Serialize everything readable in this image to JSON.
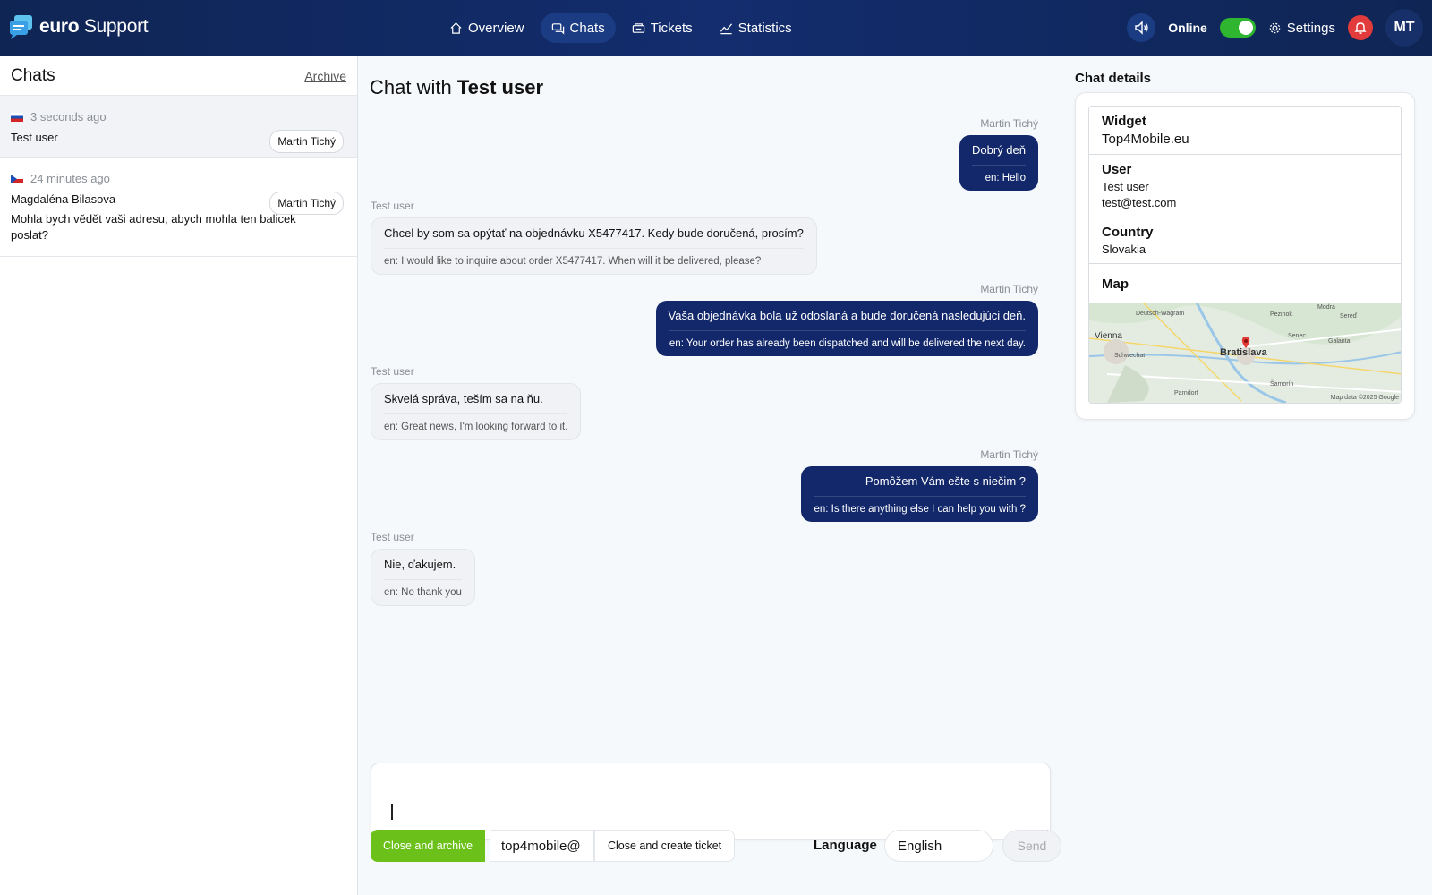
{
  "app": {
    "brand_bold": "euro",
    "brand_light": " Support"
  },
  "nav": [
    {
      "label": "Overview",
      "icon": "home-icon"
    },
    {
      "label": "Chats",
      "icon": "chat-icon",
      "active": true
    },
    {
      "label": "Tickets",
      "icon": "ticket-icon"
    },
    {
      "label": "Statistics",
      "icon": "chart-icon"
    }
  ],
  "header": {
    "online_label": "Online",
    "online": true,
    "settings_label": "Settings",
    "avatar_initials": "MT"
  },
  "colors": {
    "topbar": "#0f2554",
    "accent_green": "#6bc11a",
    "out_bubble": "#12286a",
    "alert_red": "#e23b3b"
  },
  "chats_panel": {
    "title": "Chats",
    "archive_label": "Archive",
    "items": [
      {
        "flag": "sk",
        "time": "3 seconds ago",
        "name": "Test user",
        "agent": "Martin Tichý",
        "preview": ""
      },
      {
        "flag": "cz",
        "time": "24 minutes ago",
        "name": "Magdaléna Bilasova",
        "agent": "Martin Tichý",
        "preview": "Mohla bych vědět vaši adresu, abych mohla ten balicek poslat?"
      }
    ]
  },
  "chat": {
    "title_prefix": "Chat with",
    "title_user": "Test user",
    "messages": [
      {
        "dir": "out",
        "who": "Martin Tichý",
        "text": "Dobrý deň",
        "translation": "en: Hello"
      },
      {
        "dir": "in",
        "who": "Test user",
        "text": "Chcel by som sa opýtať na objednávku X5477417. Kedy bude doručená, prosím?",
        "translation": "en: I would like to inquire about order X5477417. When will it be delivered, please?"
      },
      {
        "dir": "out",
        "who": "Martin Tichý",
        "text": "Vaša objednávka bola už odoslaná a bude doručená nasledujúci deň.",
        "translation": "en: Your order has already been dispatched and will be delivered the next day."
      },
      {
        "dir": "in",
        "who": "Test user",
        "text": "Skvelá správa, teším sa na ňu.",
        "translation": "en: Great news, I'm looking forward to it."
      },
      {
        "dir": "out",
        "who": "Martin Tichý",
        "text": "Pomôžem Vám ešte s niečim ?",
        "translation": "en: Is there anything else I can help you with ?"
      },
      {
        "dir": "in",
        "who": "Test user",
        "text": "Nie, ďakujem.",
        "translation": "en: No thank you"
      }
    ],
    "composer_value": "",
    "close_archive_label": "Close and archive",
    "email_value": "top4mobile@",
    "close_ticket_label": "Close and create ticket",
    "language_label": "Language",
    "language_value": "English",
    "send_label": "Send"
  },
  "details": {
    "title": "Chat details",
    "widget_label": "Widget",
    "widget_value": "Top4Mobile.eu",
    "user_label": "User",
    "user_name": "Test user",
    "user_email": "test@test.com",
    "country_label": "Country",
    "country_value": "Slovakia",
    "map_label": "Map",
    "map_places": {
      "vienna": "Vienna",
      "bratislava": "Bratislava",
      "deutsch_wagram": "Deutsch-Wagram",
      "modra": "Modra",
      "pezinok": "Pezinok",
      "sered": "Sereď",
      "schwechat": "Schwechat",
      "samorin": "Šamorín",
      "parndorf": "Parndorf",
      "senec": "Senec",
      "galanta": "Galanta",
      "credits": "Map data ©2025 Google"
    }
  }
}
